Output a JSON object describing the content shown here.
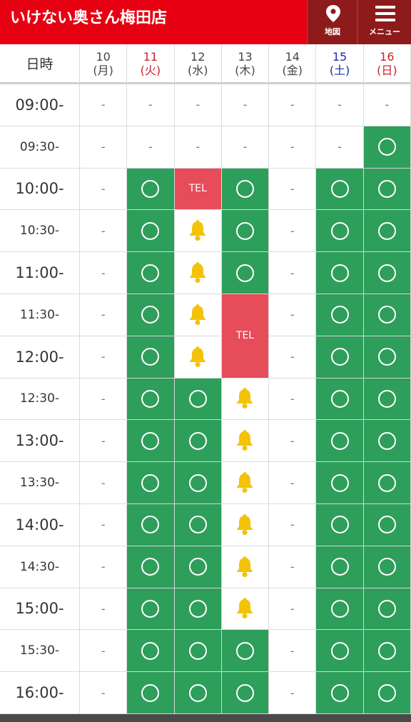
{
  "header": {
    "title": "いけない奥さん梅田店",
    "map_label": "地図",
    "menu_label": "メニュー",
    "background_color": "#e60012",
    "button_color": "#8e1b1b",
    "map_icon": "map-pin-icon",
    "menu_icon": "hamburger-menu-icon"
  },
  "legend_colors": {
    "available": "#2e9e5b",
    "tel": "#e74c5a",
    "bell": "#f5c20a",
    "saturday": "#1a2ea8",
    "holiday": "#d0202a"
  },
  "schedule": {
    "corner_label": "日時",
    "days": [
      {
        "date": "10",
        "weekday": "(月)",
        "color": "#444444"
      },
      {
        "date": "11",
        "weekday": "(火)",
        "color": "#d0202a"
      },
      {
        "date": "12",
        "weekday": "(水)",
        "color": "#444444"
      },
      {
        "date": "13",
        "weekday": "(木)",
        "color": "#444444"
      },
      {
        "date": "14",
        "weekday": "(金)",
        "color": "#444444"
      },
      {
        "date": "15",
        "weekday": "(土)",
        "color": "#1a2ea8"
      },
      {
        "date": "16",
        "weekday": "(日)",
        "color": "#d0202a"
      }
    ],
    "rows": [
      {
        "time": "09:00-",
        "slots": [
          "-",
          "-",
          "-",
          "-",
          "-",
          "-",
          "-"
        ]
      },
      {
        "time": "09:30-",
        "slots": [
          "-",
          "-",
          "-",
          "-",
          "-",
          "-",
          "o"
        ]
      },
      {
        "time": "10:00-",
        "slots": [
          "-",
          "o",
          "TEL",
          "o",
          "-",
          "o",
          "o"
        ]
      },
      {
        "time": "10:30-",
        "slots": [
          "-",
          "o",
          "bell",
          "o",
          "-",
          "o",
          "o"
        ]
      },
      {
        "time": "11:00-",
        "slots": [
          "-",
          "o",
          "bell",
          "o",
          "-",
          "o",
          "o"
        ]
      },
      {
        "time": "11:30-",
        "slots": [
          "-",
          "o",
          "bell",
          "TEL2",
          "-",
          "o",
          "o"
        ]
      },
      {
        "time": "12:00-",
        "slots": [
          "-",
          "o",
          "bell",
          "span",
          "-",
          "o",
          "o"
        ]
      },
      {
        "time": "12:30-",
        "slots": [
          "-",
          "o",
          "o",
          "bell",
          "-",
          "o",
          "o"
        ]
      },
      {
        "time": "13:00-",
        "slots": [
          "-",
          "o",
          "o",
          "bell",
          "-",
          "o",
          "o"
        ]
      },
      {
        "time": "13:30-",
        "slots": [
          "-",
          "o",
          "o",
          "bell",
          "-",
          "o",
          "o"
        ]
      },
      {
        "time": "14:00-",
        "slots": [
          "-",
          "o",
          "o",
          "bell",
          "-",
          "o",
          "o"
        ]
      },
      {
        "time": "14:30-",
        "slots": [
          "-",
          "o",
          "o",
          "bell",
          "-",
          "o",
          "o"
        ]
      },
      {
        "time": "15:00-",
        "slots": [
          "-",
          "o",
          "o",
          "bell",
          "-",
          "o",
          "o"
        ]
      },
      {
        "time": "15:30-",
        "slots": [
          "-",
          "o",
          "o",
          "o",
          "-",
          "o",
          "o"
        ]
      },
      {
        "time": "16:00-",
        "slots": [
          "-",
          "o",
          "o",
          "o",
          "-",
          "o",
          "o"
        ]
      }
    ],
    "tel_label": "TEL",
    "dash_label": "-"
  }
}
